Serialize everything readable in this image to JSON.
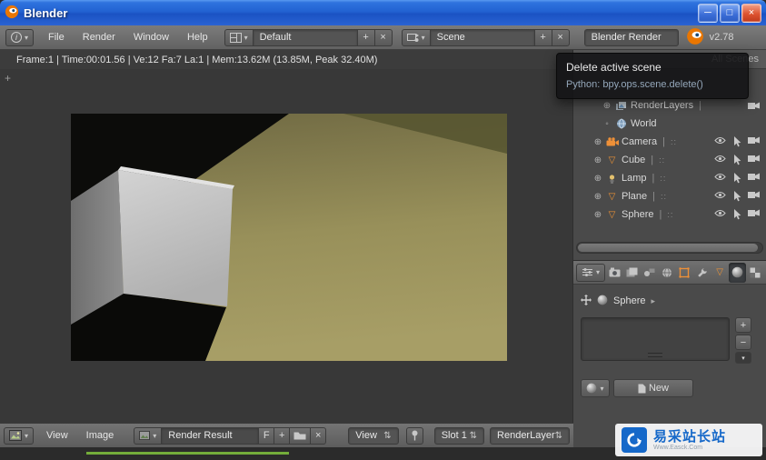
{
  "window": {
    "title": "Blender"
  },
  "titlebar_controls": {
    "minimize": "─",
    "maximize": "□",
    "close": "×"
  },
  "infobar": {
    "menus": [
      {
        "label": "File"
      },
      {
        "label": "Render"
      },
      {
        "label": "Window"
      },
      {
        "label": "Help"
      }
    ],
    "layout_selector": {
      "value": "Default",
      "add": "+",
      "close": "×"
    },
    "scene_selector": {
      "value": "Scene",
      "add": "+",
      "close": "×"
    },
    "engine_selector": {
      "value": "Blender Render"
    },
    "version": "v2.78"
  },
  "stats_bar": {
    "text": "Frame:1 | Time:00:01.56 | Ve:12 Fa:7 La:1 | Mem:13.62M (13.85M, Peak 32.40M)"
  },
  "tooltip": {
    "title": "Delete active scene",
    "python": "Python: bpy.ops.scene.delete()"
  },
  "outliner": {
    "header_label": "All Scenes",
    "items": [
      {
        "label": "RenderLayers",
        "icon": "renderlayers-icon",
        "expand": "⊕",
        "sep": "|"
      },
      {
        "label": "World",
        "icon": "world-icon",
        "expand": "◦",
        "sep": ""
      },
      {
        "label": "Camera",
        "icon": "camera-object-icon",
        "expand": "⊕",
        "sep": "|"
      },
      {
        "label": "Cube",
        "icon": "mesh-icon",
        "expand": "⊕",
        "sep": "|"
      },
      {
        "label": "Lamp",
        "icon": "lamp-icon",
        "expand": "⊕",
        "sep": "|"
      },
      {
        "label": "Plane",
        "icon": "mesh-icon",
        "expand": "⊕",
        "sep": "|"
      },
      {
        "label": "Sphere",
        "icon": "mesh-icon",
        "expand": "⊕",
        "sep": "|"
      }
    ],
    "toggle_icons": [
      "eye",
      "cursor",
      "camera"
    ]
  },
  "properties": {
    "tabs": [
      "render",
      "render-layers",
      "scene",
      "world",
      "object",
      "modifiers",
      "data",
      "material",
      "texture"
    ],
    "breadcrumb": {
      "object_name": "Sphere",
      "chevron": "▸"
    },
    "slot_list": {
      "add": "+",
      "remove": "−",
      "specials": "▾"
    },
    "material": {
      "new_label": "New"
    }
  },
  "image_editor": {
    "menus": [
      {
        "label": "View"
      },
      {
        "label": "Image"
      }
    ],
    "datablock": {
      "value": "Render Result",
      "fake_user": "F",
      "add": "+",
      "close": "×"
    },
    "view_selector": {
      "value": "View"
    },
    "slot_selector": {
      "value": "Slot 1"
    },
    "layer_selector": {
      "value": "RenderLayer"
    }
  },
  "watermark": {
    "title": "易采站长站",
    "subtitle": "Www.Easck.Com"
  },
  "icons": {
    "dropdown": "▾",
    "updown": "⇅",
    "dots": "::",
    "mesh": "▽",
    "region_plus": "+",
    "info": "i"
  },
  "colors": {
    "accent_orange": "#ee9038",
    "titlebar_blue": "#2262d2",
    "tooltip_python_text": "#94a7ba",
    "timeline_green": "#74ad3a",
    "watermark_blue": "#1568c9"
  }
}
